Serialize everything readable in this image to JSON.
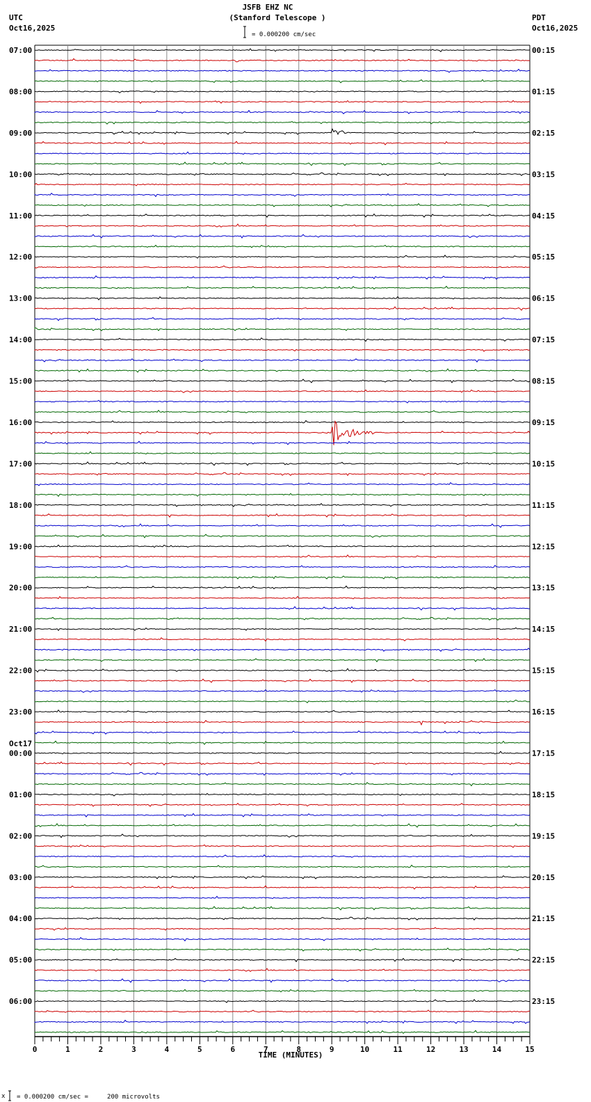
{
  "header": {
    "title": "JSFB EHZ NC",
    "subtitle": "(Stanford Telescope )",
    "left_tz": "UTC",
    "left_date": "Oct16,2025",
    "right_tz": "PDT",
    "right_date": "Oct16,2025",
    "scale_label": "= 0.000200 cm/sec"
  },
  "footer": {
    "scale_note": "= 0.000200 cm/sec =     200 microvolts",
    "marker": "x"
  },
  "chart_data": {
    "type": "line",
    "title": "JSFB EHZ NC (Stanford Telescope )",
    "xlabel": "TIME (MINUTES)",
    "xlim": [
      0,
      15
    ],
    "x_ticks": [
      "0",
      "1",
      "2",
      "3",
      "4",
      "5",
      "6",
      "7",
      "8",
      "9",
      "10",
      "11",
      "12",
      "13",
      "14",
      "15"
    ],
    "traces_per_hour": 4,
    "trace_colors": [
      "#000000",
      "#cc0000",
      "#0000cc",
      "#006600"
    ],
    "left_labels": [
      "07:00",
      "08:00",
      "09:00",
      "10:00",
      "11:00",
      "12:00",
      "13:00",
      "14:00",
      "15:00",
      "16:00",
      "17:00",
      "18:00",
      "19:00",
      "20:00",
      "21:00",
      "22:00",
      "23:00",
      "00:00",
      "01:00",
      "02:00",
      "03:00",
      "04:00",
      "05:00",
      "06:00"
    ],
    "date_change_label": "Oct17",
    "right_labels": [
      "00:15",
      "01:15",
      "02:15",
      "03:15",
      "04:15",
      "05:15",
      "06:15",
      "07:15",
      "08:15",
      "09:15",
      "10:15",
      "11:15",
      "12:15",
      "13:15",
      "14:15",
      "15:15",
      "16:15",
      "17:15",
      "18:15",
      "19:15",
      "20:15",
      "21:15",
      "22:15",
      "23:15"
    ],
    "events": [
      {
        "trace": 8,
        "minute": 9.0,
        "amplitude": 8,
        "duration": 0.4
      },
      {
        "trace": 8,
        "minute": 9.25,
        "amplitude": 6,
        "duration": 0.3
      },
      {
        "trace": 37,
        "minute": 9.0,
        "amplitude": 28,
        "duration": 1.3
      },
      {
        "trace": 51,
        "minute": 2.3,
        "amplitude": 4,
        "duration": 0.2
      },
      {
        "trace": 65,
        "minute": 11.7,
        "amplitude": 5,
        "duration": 0.15
      },
      {
        "trace": 65,
        "minute": 13.2,
        "amplitude": 5,
        "duration": 0.15
      }
    ]
  }
}
